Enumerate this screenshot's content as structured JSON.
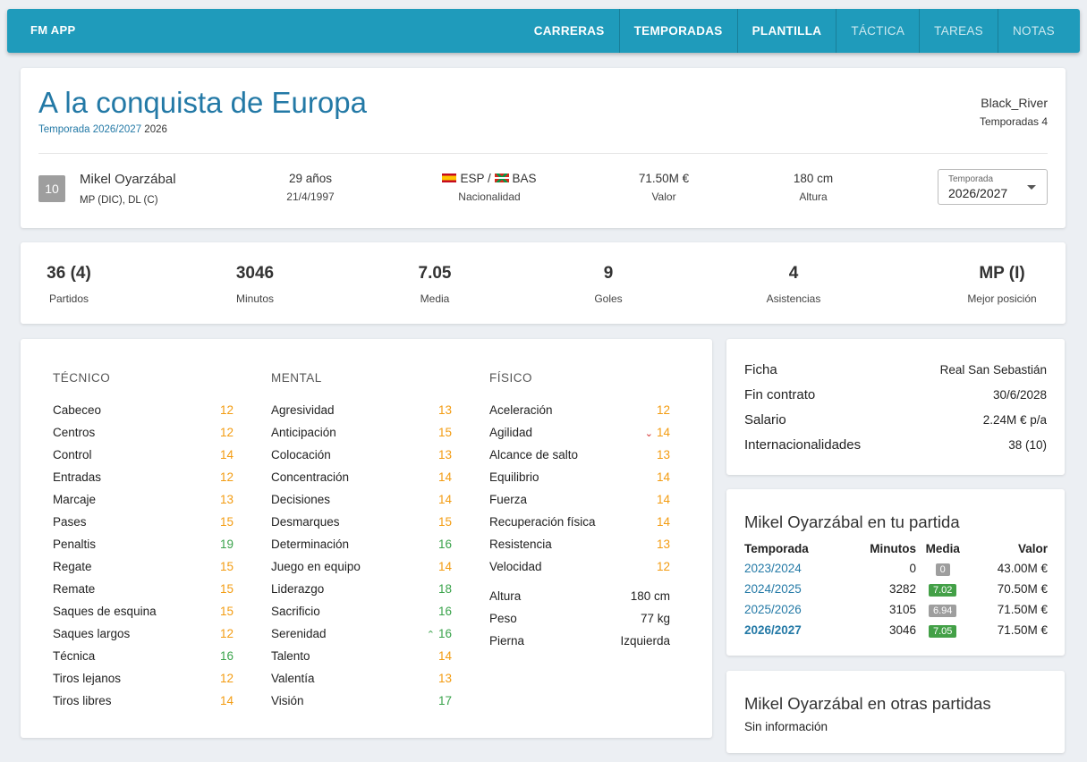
{
  "app": {
    "brand": "FM APP"
  },
  "nav": [
    {
      "label": "CARRERAS",
      "muted": false
    },
    {
      "label": "TEMPORADAS",
      "muted": false
    },
    {
      "label": "PLANTILLA",
      "muted": false
    },
    {
      "label": "TÁCTICA",
      "muted": true
    },
    {
      "label": "TAREAS",
      "muted": true
    },
    {
      "label": "NOTAS",
      "muted": true
    }
  ],
  "career": {
    "title": "A la conquista de Europa",
    "season_link": "Temporada 2026/2027",
    "year": "2026",
    "manager": "Black_River",
    "seasons_count": "Temporadas 4"
  },
  "player": {
    "number": "10",
    "name": "Mikel Oyarzábal",
    "positions": "MP (DIC), DL (C)",
    "age": "29 años",
    "birthdate": "21/4/1997",
    "nationality_1": "ESP",
    "nationality_sep": "/",
    "nationality_2": "BAS",
    "nationality_label": "Nacionalidad",
    "value": "71.50M €",
    "value_label": "Valor",
    "height": "180 cm",
    "height_label": "Altura",
    "season_select": {
      "label": "Temporada",
      "value": "2026/2027"
    }
  },
  "stats": [
    {
      "value": "36 (4)",
      "label": "Partidos"
    },
    {
      "value": "3046",
      "label": "Minutos"
    },
    {
      "value": "7.05",
      "label": "Media"
    },
    {
      "value": "9",
      "label": "Goles"
    },
    {
      "value": "4",
      "label": "Asistencias"
    },
    {
      "value": "MP (I)",
      "label": "Mejor posición"
    }
  ],
  "attributes": {
    "tecnico": {
      "title": "TÉCNICO",
      "items": [
        {
          "name": "Cabeceo",
          "value": "12",
          "color": "orange"
        },
        {
          "name": "Centros",
          "value": "12",
          "color": "orange"
        },
        {
          "name": "Control",
          "value": "14",
          "color": "orange"
        },
        {
          "name": "Entradas",
          "value": "12",
          "color": "orange"
        },
        {
          "name": "Marcaje",
          "value": "13",
          "color": "orange"
        },
        {
          "name": "Pases",
          "value": "15",
          "color": "orange"
        },
        {
          "name": "Penaltis",
          "value": "19",
          "color": "green"
        },
        {
          "name": "Regate",
          "value": "15",
          "color": "orange"
        },
        {
          "name": "Remate",
          "value": "15",
          "color": "orange"
        },
        {
          "name": "Saques de esquina",
          "value": "15",
          "color": "orange"
        },
        {
          "name": "Saques largos",
          "value": "12",
          "color": "orange"
        },
        {
          "name": "Técnica",
          "value": "16",
          "color": "green"
        },
        {
          "name": "Tiros lejanos",
          "value": "12",
          "color": "orange"
        },
        {
          "name": "Tiros libres",
          "value": "14",
          "color": "orange"
        }
      ]
    },
    "mental": {
      "title": "MENTAL",
      "items": [
        {
          "name": "Agresividad",
          "value": "13",
          "color": "orange"
        },
        {
          "name": "Anticipación",
          "value": "15",
          "color": "orange"
        },
        {
          "name": "Colocación",
          "value": "13",
          "color": "orange"
        },
        {
          "name": "Concentración",
          "value": "14",
          "color": "orange"
        },
        {
          "name": "Decisiones",
          "value": "14",
          "color": "orange"
        },
        {
          "name": "Desmarques",
          "value": "15",
          "color": "orange"
        },
        {
          "name": "Determinación",
          "value": "16",
          "color": "green"
        },
        {
          "name": "Juego en equipo",
          "value": "14",
          "color": "orange"
        },
        {
          "name": "Liderazgo",
          "value": "18",
          "color": "green"
        },
        {
          "name": "Sacrificio",
          "value": "16",
          "color": "green"
        },
        {
          "name": "Serenidad",
          "value": "16",
          "color": "green",
          "trend": "up"
        },
        {
          "name": "Talento",
          "value": "14",
          "color": "orange"
        },
        {
          "name": "Valentía",
          "value": "13",
          "color": "orange"
        },
        {
          "name": "Visión",
          "value": "17",
          "color": "green"
        }
      ]
    },
    "fisico": {
      "title": "FÍSICO",
      "items": [
        {
          "name": "Aceleración",
          "value": "12",
          "color": "orange"
        },
        {
          "name": "Agilidad",
          "value": "14",
          "color": "orange",
          "trend": "down"
        },
        {
          "name": "Alcance de salto",
          "value": "13",
          "color": "orange"
        },
        {
          "name": "Equilibrio",
          "value": "14",
          "color": "orange"
        },
        {
          "name": "Fuerza",
          "value": "14",
          "color": "orange"
        },
        {
          "name": "Recuperación física",
          "value": "14",
          "color": "orange"
        },
        {
          "name": "Resistencia",
          "value": "13",
          "color": "orange"
        },
        {
          "name": "Velocidad",
          "value": "12",
          "color": "orange"
        }
      ],
      "extra": [
        {
          "name": "Altura",
          "value": "180 cm"
        },
        {
          "name": "Peso",
          "value": "77 kg"
        },
        {
          "name": "Pierna",
          "value": "Izquierda"
        }
      ]
    }
  },
  "contract": [
    {
      "key": "Ficha",
      "value": "Real San Sebastián"
    },
    {
      "key": "Fin contrato",
      "value": "30/6/2028"
    },
    {
      "key": "Salario",
      "value": "2.24M € p/a"
    },
    {
      "key": "Internacionalidades",
      "value": "38 (10)"
    }
  ],
  "history": {
    "title": "Mikel Oyarzábal en tu partida",
    "columns": [
      "Temporada",
      "Minutos",
      "Media",
      "Valor"
    ],
    "rows": [
      {
        "season": "2023/2024",
        "minutes": "0",
        "rating": "0",
        "rating_good": false,
        "value": "43.00M €",
        "current": false
      },
      {
        "season": "2024/2025",
        "minutes": "3282",
        "rating": "7.02",
        "rating_good": true,
        "value": "70.50M €",
        "current": false
      },
      {
        "season": "2025/2026",
        "minutes": "3105",
        "rating": "6.94",
        "rating_good": false,
        "value": "71.50M €",
        "current": false
      },
      {
        "season": "2026/2027",
        "minutes": "3046",
        "rating": "7.05",
        "rating_good": true,
        "value": "71.50M €",
        "current": true
      }
    ]
  },
  "other": {
    "title": "Mikel Oyarzábal en otras partidas",
    "text": "Sin información"
  },
  "colors": {
    "appbar": "#1f9bbb",
    "link": "#2379a6",
    "orange": "#f39c12",
    "green": "#3aa34b"
  }
}
